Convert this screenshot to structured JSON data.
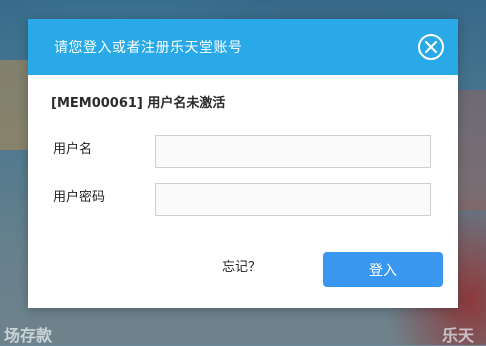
{
  "background": {
    "banner_text_left": "场存款",
    "banner_text_right": "乐天"
  },
  "modal": {
    "title": "请您登入或者注册乐天堂账号",
    "close_icon": "close-circle-icon",
    "error_message": "[MEM00061] 用户名未激活",
    "username_label": "用户名",
    "username_value": "",
    "password_label": "用户密码",
    "password_value": "",
    "forgot_label": "忘记？",
    "login_label": "登入"
  },
  "colors": {
    "header": "#29a9e8",
    "button": "#3a97f0"
  }
}
